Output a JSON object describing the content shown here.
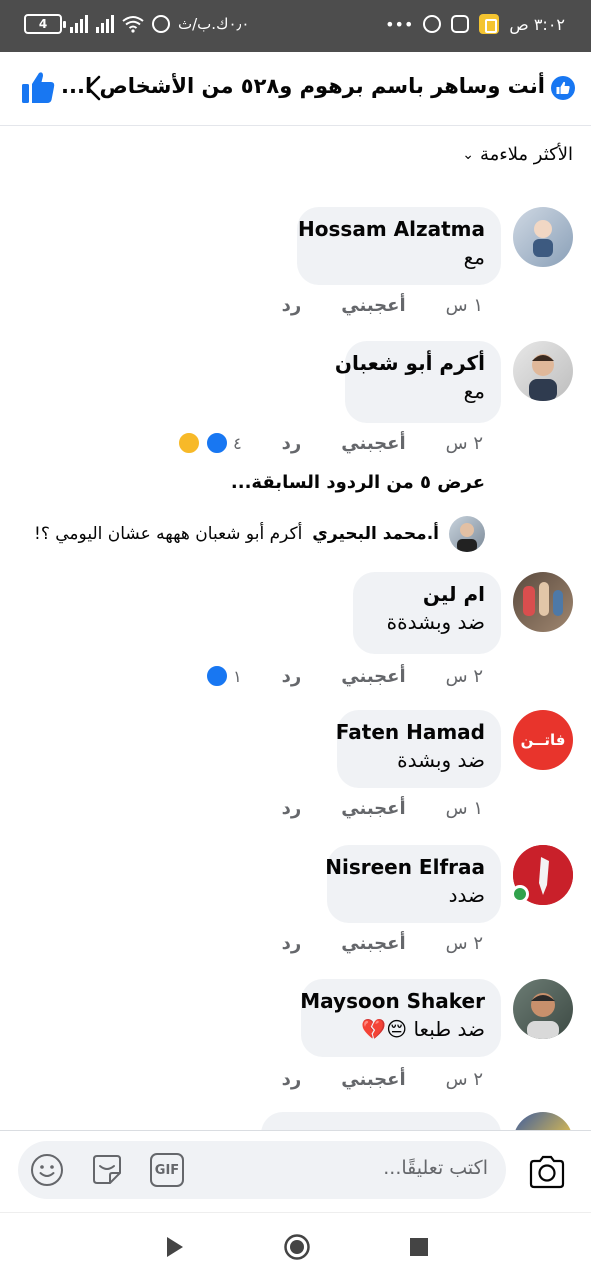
{
  "status_bar": {
    "battery": "4",
    "speed": "٠٫٠ك.ب/ث",
    "dots": "•••",
    "time": "٣:٠٢ ص"
  },
  "header": {
    "reactors_title": "أنت وساهر باسم برهوم و٥٢٨ من الأشخاص ا..."
  },
  "sort": {
    "label": "الأكثر ملاءمة"
  },
  "comments": [
    {
      "name": "Hossam Alzatma",
      "text": "مع",
      "time": "١ س",
      "like": "أعجبني",
      "reply": "رد"
    },
    {
      "name": "أكرم أبو شعبان",
      "text": "مع",
      "time": "٢ س",
      "like": "أعجبني",
      "reply": "رد",
      "reactions": "٤"
    },
    {
      "name": "ام لين",
      "text": "ضد وبشدةة",
      "time": "٢ س",
      "like": "أعجبني",
      "reply": "رد",
      "reactions": "١"
    },
    {
      "name": "Faten Hamad",
      "text": "ضد وبشدة",
      "time": "١ س",
      "like": "أعجبني",
      "reply": "رد",
      "avatar_text": "فاتــن"
    },
    {
      "name": "Nisreen Elfraa",
      "text": "ضدد",
      "time": "٢ س",
      "like": "أعجبني",
      "reply": "رد"
    },
    {
      "name": "Maysoon Shaker",
      "text": "ضد طبعا 😔💔",
      "time": "٢ س",
      "like": "أعجبني",
      "reply": "رد"
    }
  ],
  "view_previous": "عرض ٥ من الردود السابقة...",
  "reply_preview": {
    "name": "أ.محمد البحيري",
    "text": "أكرم أبو شعبان هههه عشان اليومي ؟!"
  },
  "composer": {
    "placeholder": "اكتب تعليقًا...",
    "gif": "GIF"
  },
  "colors": {
    "accent": "#1877f2",
    "status_bar": "#4d4d4d",
    "bubble": "#f0f2f5"
  }
}
